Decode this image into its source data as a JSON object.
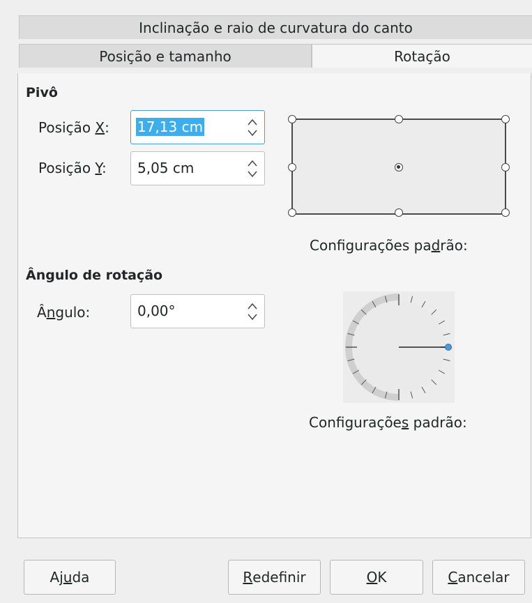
{
  "tabs": {
    "row1": [
      "Inclinação e raio de curvatura do canto"
    ],
    "row2_first": "Posição e tamanho",
    "row2_second": "Rotação"
  },
  "pivot": {
    "heading": "Pivô",
    "pos_x_label_pre": "Posição ",
    "pos_x_label_key": "X",
    "pos_x_label_post": ":",
    "pos_x_value": "17,13 cm",
    "pos_y_label_pre": "Posição ",
    "pos_y_label_key": "Y",
    "pos_y_label_post": ":",
    "pos_y_value": "5,05 cm",
    "defaults_pre": "Configurações pa",
    "defaults_key": "d",
    "defaults_post": "rão:"
  },
  "rotation": {
    "heading": "Ângulo de rotação",
    "angle_label_pre": "Â",
    "angle_label_key": "n",
    "angle_label_post": "gulo:",
    "angle_value": "0,00°",
    "defaults_pre": "Configuraçõe",
    "defaults_key": "s",
    "defaults_post": " padrão:"
  },
  "buttons": {
    "help_pre": "Aj",
    "help_key": "u",
    "help_post": "da",
    "reset_pre": "",
    "reset_key": "R",
    "reset_post": "edefinir",
    "ok_pre": "",
    "ok_key": "O",
    "ok_post": "K",
    "cancel_pre": "",
    "cancel_key": "C",
    "cancel_post": "ancelar"
  },
  "colors": {
    "accent": "#3daee9",
    "dial_handle": "#4d9ad8"
  }
}
